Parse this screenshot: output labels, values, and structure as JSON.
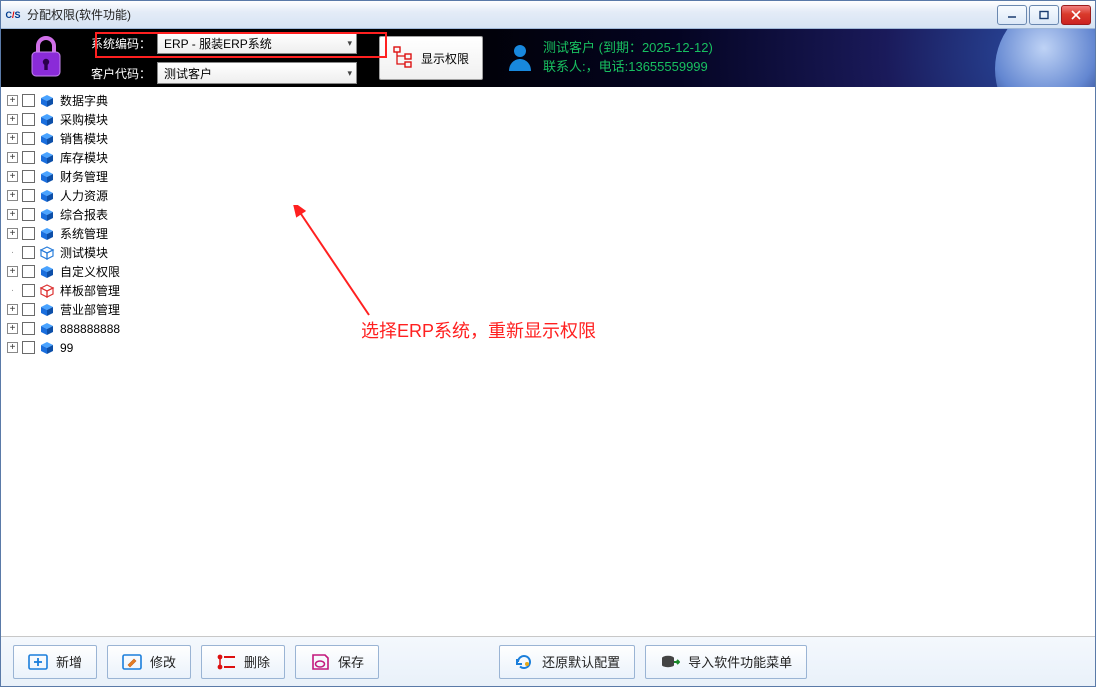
{
  "window": {
    "title": "分配权限(软件功能)"
  },
  "header": {
    "system_code_label": "系统编码：",
    "system_code_value": "ERP - 服装ERP系统",
    "customer_code_label": "客户代码：",
    "customer_code_value": "测试客户",
    "show_permission_label": "显示权限",
    "customer_line1": "测试客户 (到期：2025-12-12)",
    "customer_line2": "联系人:，电话:13655559999"
  },
  "annotation": {
    "text": "选择ERP系统，重新显示权限"
  },
  "tree": {
    "items": [
      {
        "label": "数据字典",
        "expandable": true,
        "cube": "blue"
      },
      {
        "label": "采购模块",
        "expandable": true,
        "cube": "blue"
      },
      {
        "label": "销售模块",
        "expandable": true,
        "cube": "blue"
      },
      {
        "label": "库存模块",
        "expandable": true,
        "cube": "blue"
      },
      {
        "label": "财务管理",
        "expandable": true,
        "cube": "blue"
      },
      {
        "label": "人力资源",
        "expandable": true,
        "cube": "blue"
      },
      {
        "label": "综合报表",
        "expandable": true,
        "cube": "blue"
      },
      {
        "label": "系统管理",
        "expandable": true,
        "cube": "blue"
      },
      {
        "label": "测试模块",
        "expandable": false,
        "cube": "outline"
      },
      {
        "label": "自定义权限",
        "expandable": true,
        "cube": "blue"
      },
      {
        "label": "样板部管理",
        "expandable": false,
        "cube": "red"
      },
      {
        "label": "营业部管理",
        "expandable": true,
        "cube": "blue"
      },
      {
        "label": "888888888",
        "expandable": true,
        "cube": "blue"
      },
      {
        "label": "99",
        "expandable": true,
        "cube": "blue"
      }
    ]
  },
  "toolbar": {
    "add": "新增",
    "edit": "修改",
    "delete": "删除",
    "save": "保存",
    "restore": "还原默认配置",
    "import": "导入软件功能菜单"
  }
}
